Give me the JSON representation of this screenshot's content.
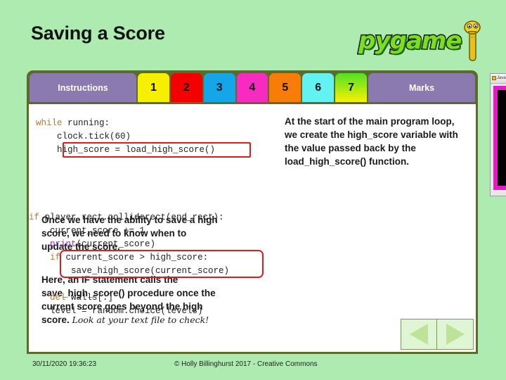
{
  "slide": {
    "title": "Saving a Score",
    "background_color": "#aeebb0",
    "panel_border_color": "#5c6b2b"
  },
  "logo": {
    "word": "pygame",
    "mascot_name": "pygame-snake-mascot"
  },
  "tabs": [
    {
      "label": "Instructions",
      "color": "#8a7ab0",
      "text_color": "#ffffff",
      "type": "wide"
    },
    {
      "label": "1",
      "color": "#f7ef00",
      "text_color": "#111111",
      "type": "num"
    },
    {
      "label": "2",
      "color": "#f40000",
      "text_color": "#111111",
      "type": "num"
    },
    {
      "label": "3",
      "color": "#14a6e8",
      "text_color": "#111111",
      "type": "num"
    },
    {
      "label": "4",
      "color": "#f72bc0",
      "text_color": "#111111",
      "type": "num"
    },
    {
      "label": "5",
      "color": "#f87c08",
      "text_color": "#111111",
      "type": "num"
    },
    {
      "label": "6",
      "color": "#63f2f2",
      "text_color": "#111111",
      "type": "num"
    },
    {
      "label": "7",
      "color": "linear-gradient(#4fe226, #f9f000)",
      "text_color": "#111111",
      "type": "num"
    },
    {
      "label": "Marks",
      "color": "#8a7ab0",
      "text_color": "#ffffff",
      "type": "wide"
    }
  ],
  "code_top": {
    "lines": [
      {
        "segments": [
          {
            "text": "while",
            "style": "kw"
          },
          {
            "text": " running:",
            "style": ""
          }
        ]
      },
      {
        "segments": [
          {
            "text": "    clock.tick(60)",
            "style": ""
          }
        ]
      },
      {
        "segments": [
          {
            "text": "    high_score = load_high_score()",
            "style": ""
          }
        ]
      }
    ],
    "highlight": "high_score = load_high_score()"
  },
  "code_bottom": {
    "lines": [
      {
        "segments": [
          {
            "text": "if",
            "style": "kw"
          },
          {
            "text": " player.rect.colliderect(end_rect):",
            "style": ""
          }
        ]
      },
      {
        "segments": [
          {
            "text": "    current_score += 1",
            "style": ""
          }
        ]
      },
      {
        "segments": [
          {
            "text": "    ",
            "style": ""
          },
          {
            "text": "print",
            "style": "fnc"
          },
          {
            "text": "(current_score)",
            "style": ""
          }
        ]
      },
      {
        "segments": [
          {
            "text": "    ",
            "style": ""
          },
          {
            "text": "if",
            "style": "kw"
          },
          {
            "text": " current_score > high_score:",
            "style": ""
          }
        ]
      },
      {
        "segments": [
          {
            "text": "        save_high_score(current_score)",
            "style": ""
          }
        ]
      },
      {
        "segments": [
          {
            "text": "",
            "style": ""
          }
        ]
      },
      {
        "segments": [
          {
            "text": "    ",
            "style": ""
          },
          {
            "text": "del",
            "style": "kw"
          },
          {
            "text": " walls[:]",
            "style": ""
          }
        ]
      },
      {
        "segments": [
          {
            "text": "    level = random.choice(levels)",
            "style": ""
          }
        ]
      }
    ],
    "highlight": "if current_score > high_score: save_high_score(current_score)"
  },
  "text_top": "At the start of the main program loop, we create the high_score variable with the value passed back by the load_high_score() function.",
  "text_mid": "Once we have the ability to save a high score, we need to know when to update the score.",
  "text_bottom_bold": "Here, an IF statement calls the save_high_score() procedure once the current score goes beyond the high score. ",
  "text_bottom_hand": "Look at your text file to check!",
  "nav": {
    "prev_label": "previous-slide",
    "next_label": "next-slide"
  },
  "footer": {
    "timestamp": "30/11/2020 19:36:23",
    "copyright": "© Holly Billinghurst 2017 - Creative Commons"
  },
  "game_window": {
    "title": "Java In..."
  }
}
